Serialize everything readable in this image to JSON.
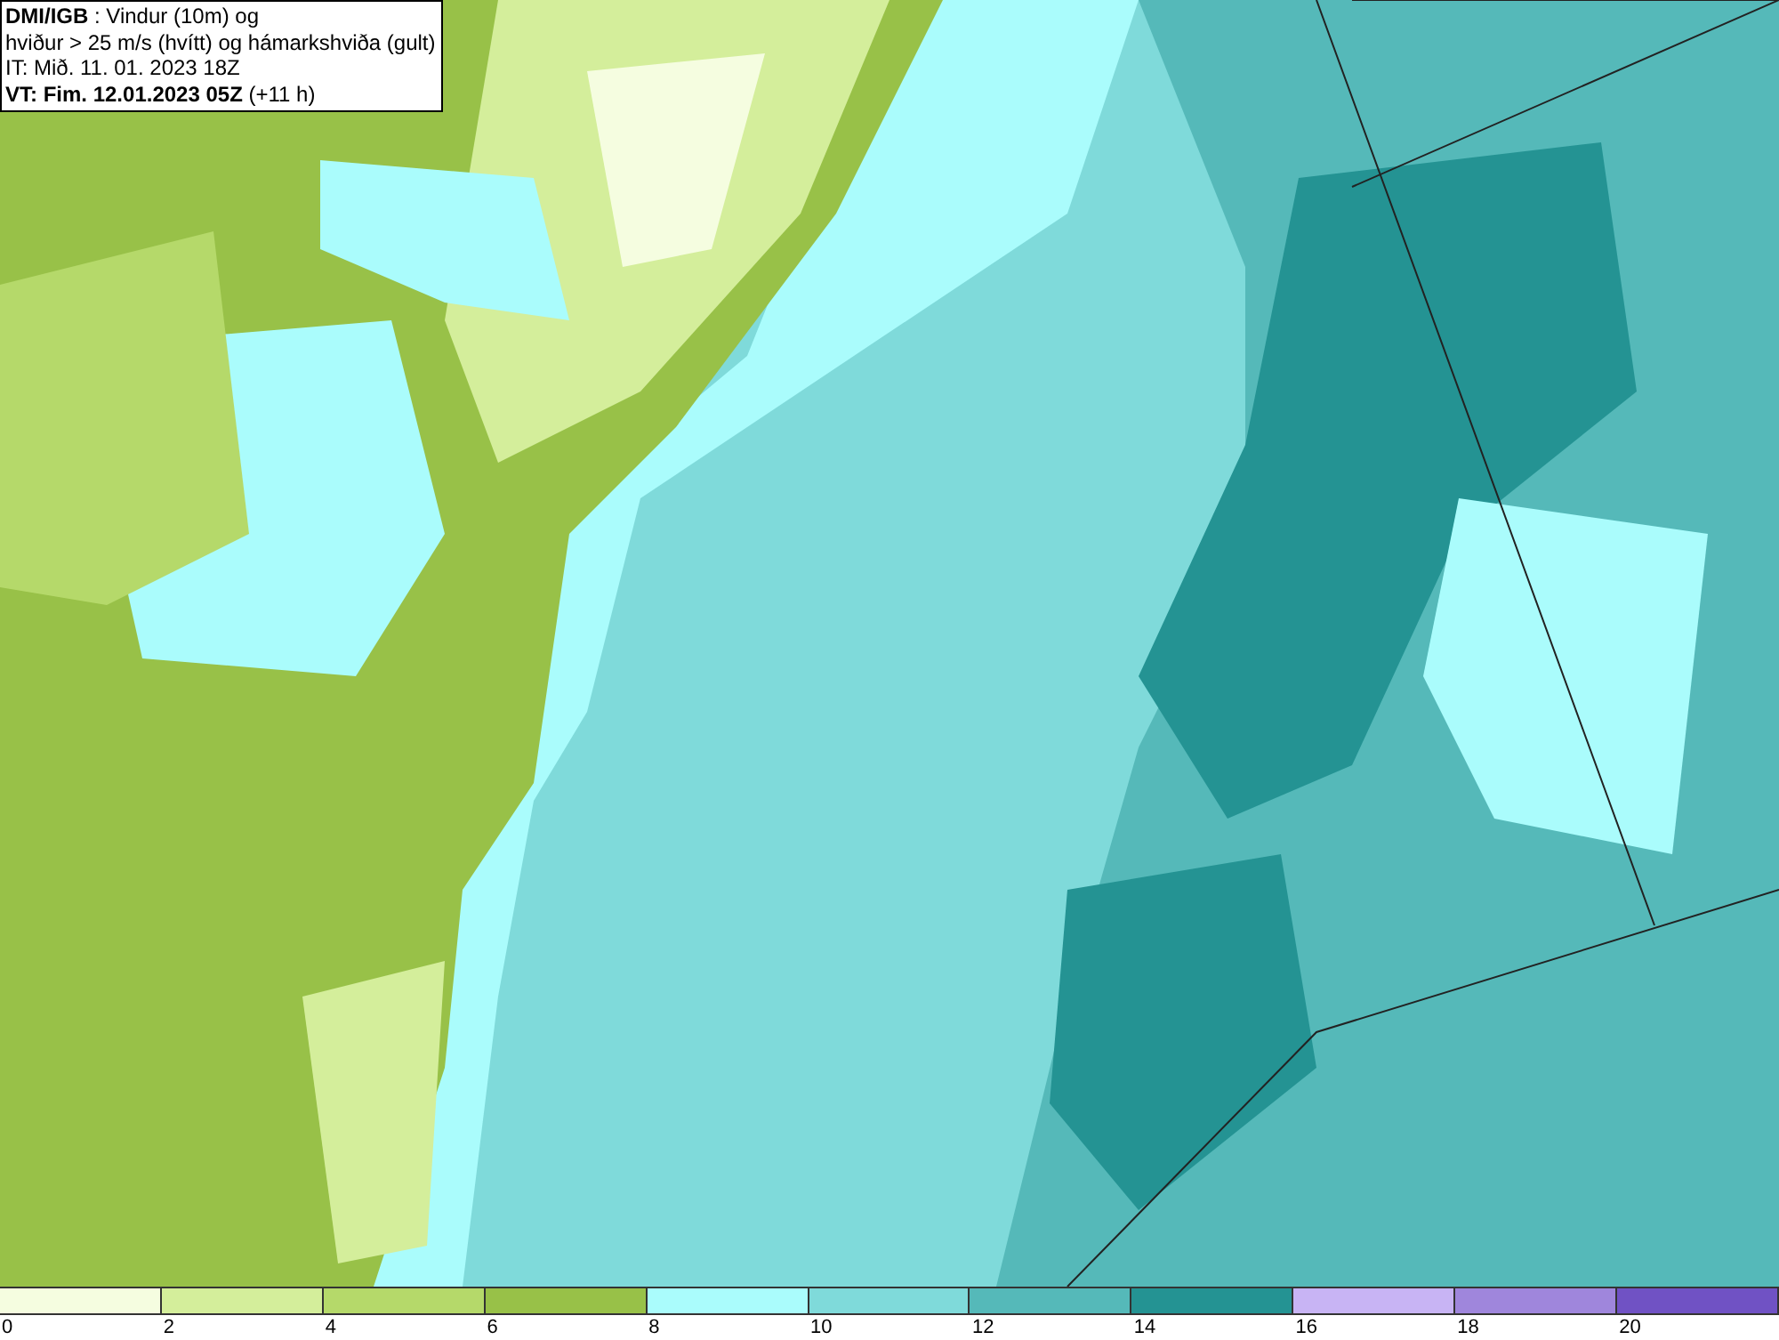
{
  "info_box": {
    "lines": [
      "**DMI/IGB** : Vindur (10m) og",
      "hviður > 25 m/s (hvítt) og hámarkshviða (gult)",
      "IT: Mið. 11. 01. 2023 18Z",
      "**VT: Fim. 12.01.2023 05Z** (+11 h)"
    ]
  },
  "legend": {
    "bins": [
      {
        "label": "0",
        "color": "#f5fde0"
      },
      {
        "label": "2",
        "color": "#d4ee9b"
      },
      {
        "label": "4",
        "color": "#b5d96a"
      },
      {
        "label": "6",
        "color": "#98c148"
      },
      {
        "label": "8",
        "color": "#aafcfc"
      },
      {
        "label": "10",
        "color": "#7fdada"
      },
      {
        "label": "12",
        "color": "#55b9b9"
      },
      {
        "label": "14",
        "color": "#249393"
      },
      {
        "label": "16",
        "color": "#c8b4f4"
      },
      {
        "label": "18",
        "color": "#9f86dc"
      },
      {
        "label": "20",
        "color": "#7052c4"
      }
    ]
  }
}
